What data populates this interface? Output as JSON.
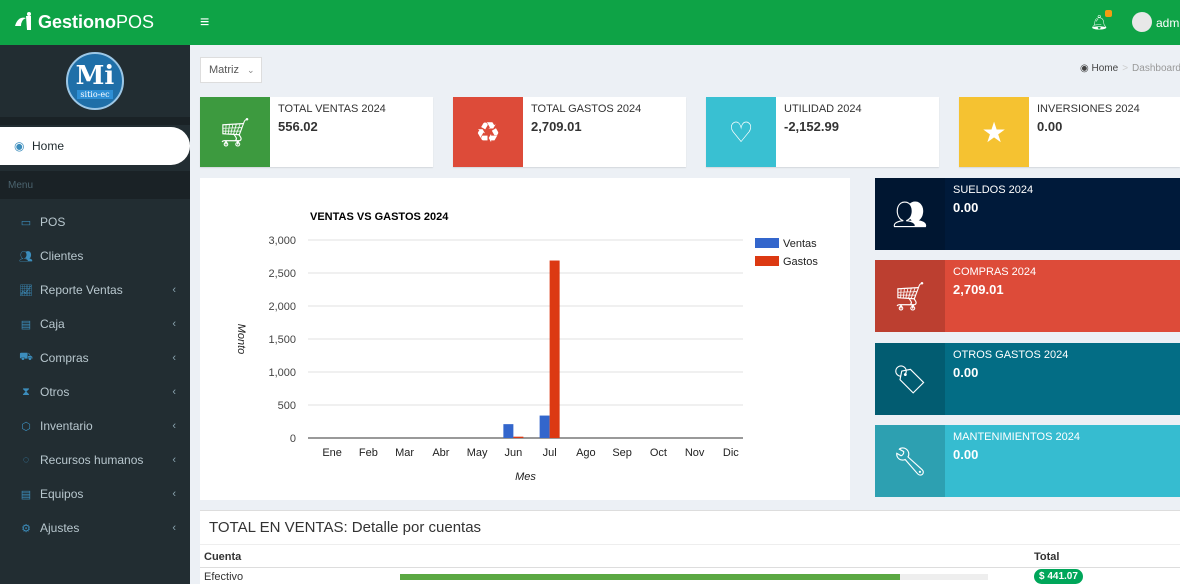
{
  "app": {
    "brand_bold": "Gestiono",
    "brand_light": "POS",
    "logo_letters": "Mi",
    "logo_sub": "sitio-ec"
  },
  "topbar": {
    "menu_icon": "hamburger-icon",
    "user_text": "adm"
  },
  "sidebar": {
    "home_label": "Home",
    "menu_header": "Menu",
    "items": [
      {
        "label": "POS",
        "icon": "monitor-icon",
        "has_children": false
      },
      {
        "label": "Clientes",
        "icon": "users-icon",
        "has_children": false
      },
      {
        "label": "Reporte Ventas",
        "icon": "line-chart-icon",
        "has_children": true
      },
      {
        "label": "Caja",
        "icon": "cash-icon",
        "has_children": true
      },
      {
        "label": "Compras",
        "icon": "cart-icon",
        "has_children": true
      },
      {
        "label": "Otros",
        "icon": "hourglass-icon",
        "has_children": true
      },
      {
        "label": "Inventario",
        "icon": "cubes-icon",
        "has_children": true
      },
      {
        "label": "Recursos humanos",
        "icon": "people-icon",
        "has_children": true
      },
      {
        "label": "Equipos",
        "icon": "desktop-icon",
        "has_children": true
      },
      {
        "label": "Ajustes",
        "icon": "gears-icon",
        "has_children": true
      }
    ]
  },
  "filter": {
    "selected": "Matriz"
  },
  "breadcrumb": {
    "home": "Home",
    "current": "Dashboard"
  },
  "info_boxes": [
    {
      "label": "TOTAL VENTAS 2024",
      "value": "556.02",
      "color": "#3d9a3f",
      "icon": "cart-plus-icon"
    },
    {
      "label": "TOTAL GASTOS 2024",
      "value": "2,709.01",
      "color": "#dd4b39",
      "icon": "recycle-icon"
    },
    {
      "label": "UTILIDAD 2024",
      "value": "-2,152.99",
      "color": "#39c0d2",
      "icon": "heart-icon"
    },
    {
      "label": "INVERSIONES 2024",
      "value": "0.00",
      "color": "#f5c231",
      "icon": "star-icon"
    }
  ],
  "side_boxes": [
    {
      "label": "SUELDOS 2024",
      "value": "0.00",
      "color": "#001a3a",
      "icon": "users-icon"
    },
    {
      "label": "COMPRAS 2024",
      "value": "2,709.01",
      "color": "#dd4b39",
      "icon": "cart-download-icon"
    },
    {
      "label": "OTROS GASTOS 2024",
      "value": "0.00",
      "color": "#036d85",
      "icon": "tag-icon"
    },
    {
      "label": "MANTENIMIENTOS 2024",
      "value": "0.00",
      "color": "#36bcd0",
      "icon": "wrench-icon"
    }
  ],
  "chart_data": {
    "type": "bar",
    "title": "VENTAS VS GASTOS 2024",
    "xlabel": "Mes",
    "ylabel": "Monto",
    "categories": [
      "Ene",
      "Feb",
      "Mar",
      "Abr",
      "May",
      "Jun",
      "Jul",
      "Ago",
      "Sep",
      "Oct",
      "Nov",
      "Dic"
    ],
    "series": [
      {
        "name": "Ventas",
        "color": "#3366cc",
        "values": [
          0,
          0,
          0,
          0,
          0,
          210,
          340,
          0,
          0,
          0,
          0,
          0
        ]
      },
      {
        "name": "Gastos",
        "color": "#dc3912",
        "values": [
          0,
          0,
          0,
          0,
          0,
          20,
          2689,
          0,
          0,
          0,
          0,
          0
        ]
      }
    ],
    "yticks": [
      "0",
      "500",
      "1,000",
      "1,500",
      "2,000",
      "2,500",
      "3,000"
    ],
    "ylim": [
      0,
      3000
    ],
    "legend": "right",
    "grid": true
  },
  "table": {
    "title": "TOTAL EN VENTAS: Detalle por cuentas",
    "col_account": "Cuenta",
    "col_total": "Total",
    "rows": [
      {
        "account": "Efectivo",
        "percent": 85,
        "total": "$ 441.07"
      }
    ]
  }
}
